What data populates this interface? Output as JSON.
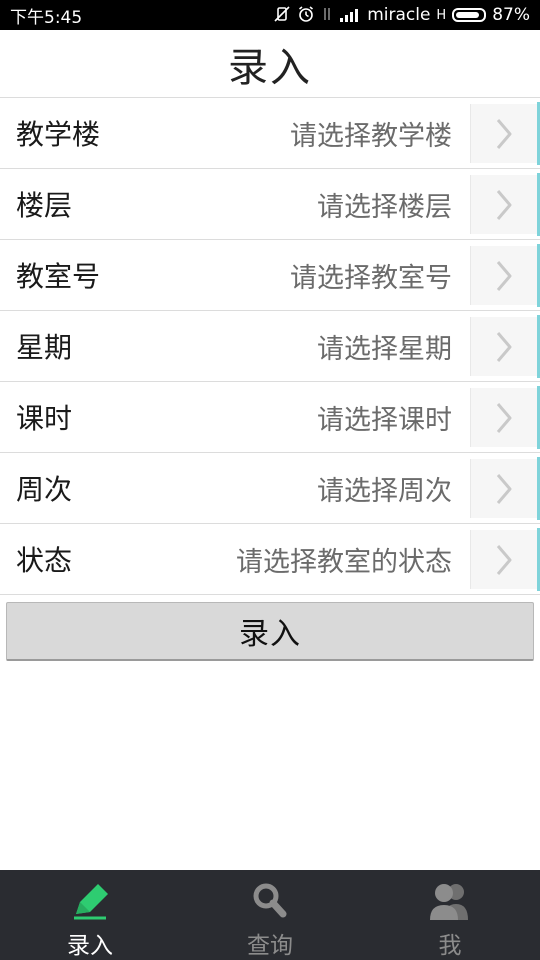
{
  "status_bar": {
    "time": "下午5:45",
    "carrier": "miracle",
    "network": "H",
    "battery": "87%",
    "battery_level": 0.87
  },
  "title": "录入",
  "form": {
    "rows": [
      {
        "label": "教学楼",
        "placeholder": "请选择教学楼"
      },
      {
        "label": "楼层",
        "placeholder": "请选择楼层"
      },
      {
        "label": "教室号",
        "placeholder": "请选择教室号"
      },
      {
        "label": "星期",
        "placeholder": "请选择星期"
      },
      {
        "label": "课时",
        "placeholder": "请选择课时"
      },
      {
        "label": "周次",
        "placeholder": "请选择周次"
      },
      {
        "label": "状态",
        "placeholder": "请选择教室的状态"
      }
    ],
    "submit_label": "录入"
  },
  "bottom_nav": {
    "items": [
      {
        "label": "录入",
        "icon": "pencil-icon",
        "active": true
      },
      {
        "label": "查询",
        "icon": "search-icon",
        "active": false
      },
      {
        "label": "我",
        "icon": "users-icon",
        "active": false
      }
    ]
  },
  "colors": {
    "accent": "#2ecc71",
    "nav_bg": "#2a2c31",
    "row_accent": "#7fd3da"
  }
}
